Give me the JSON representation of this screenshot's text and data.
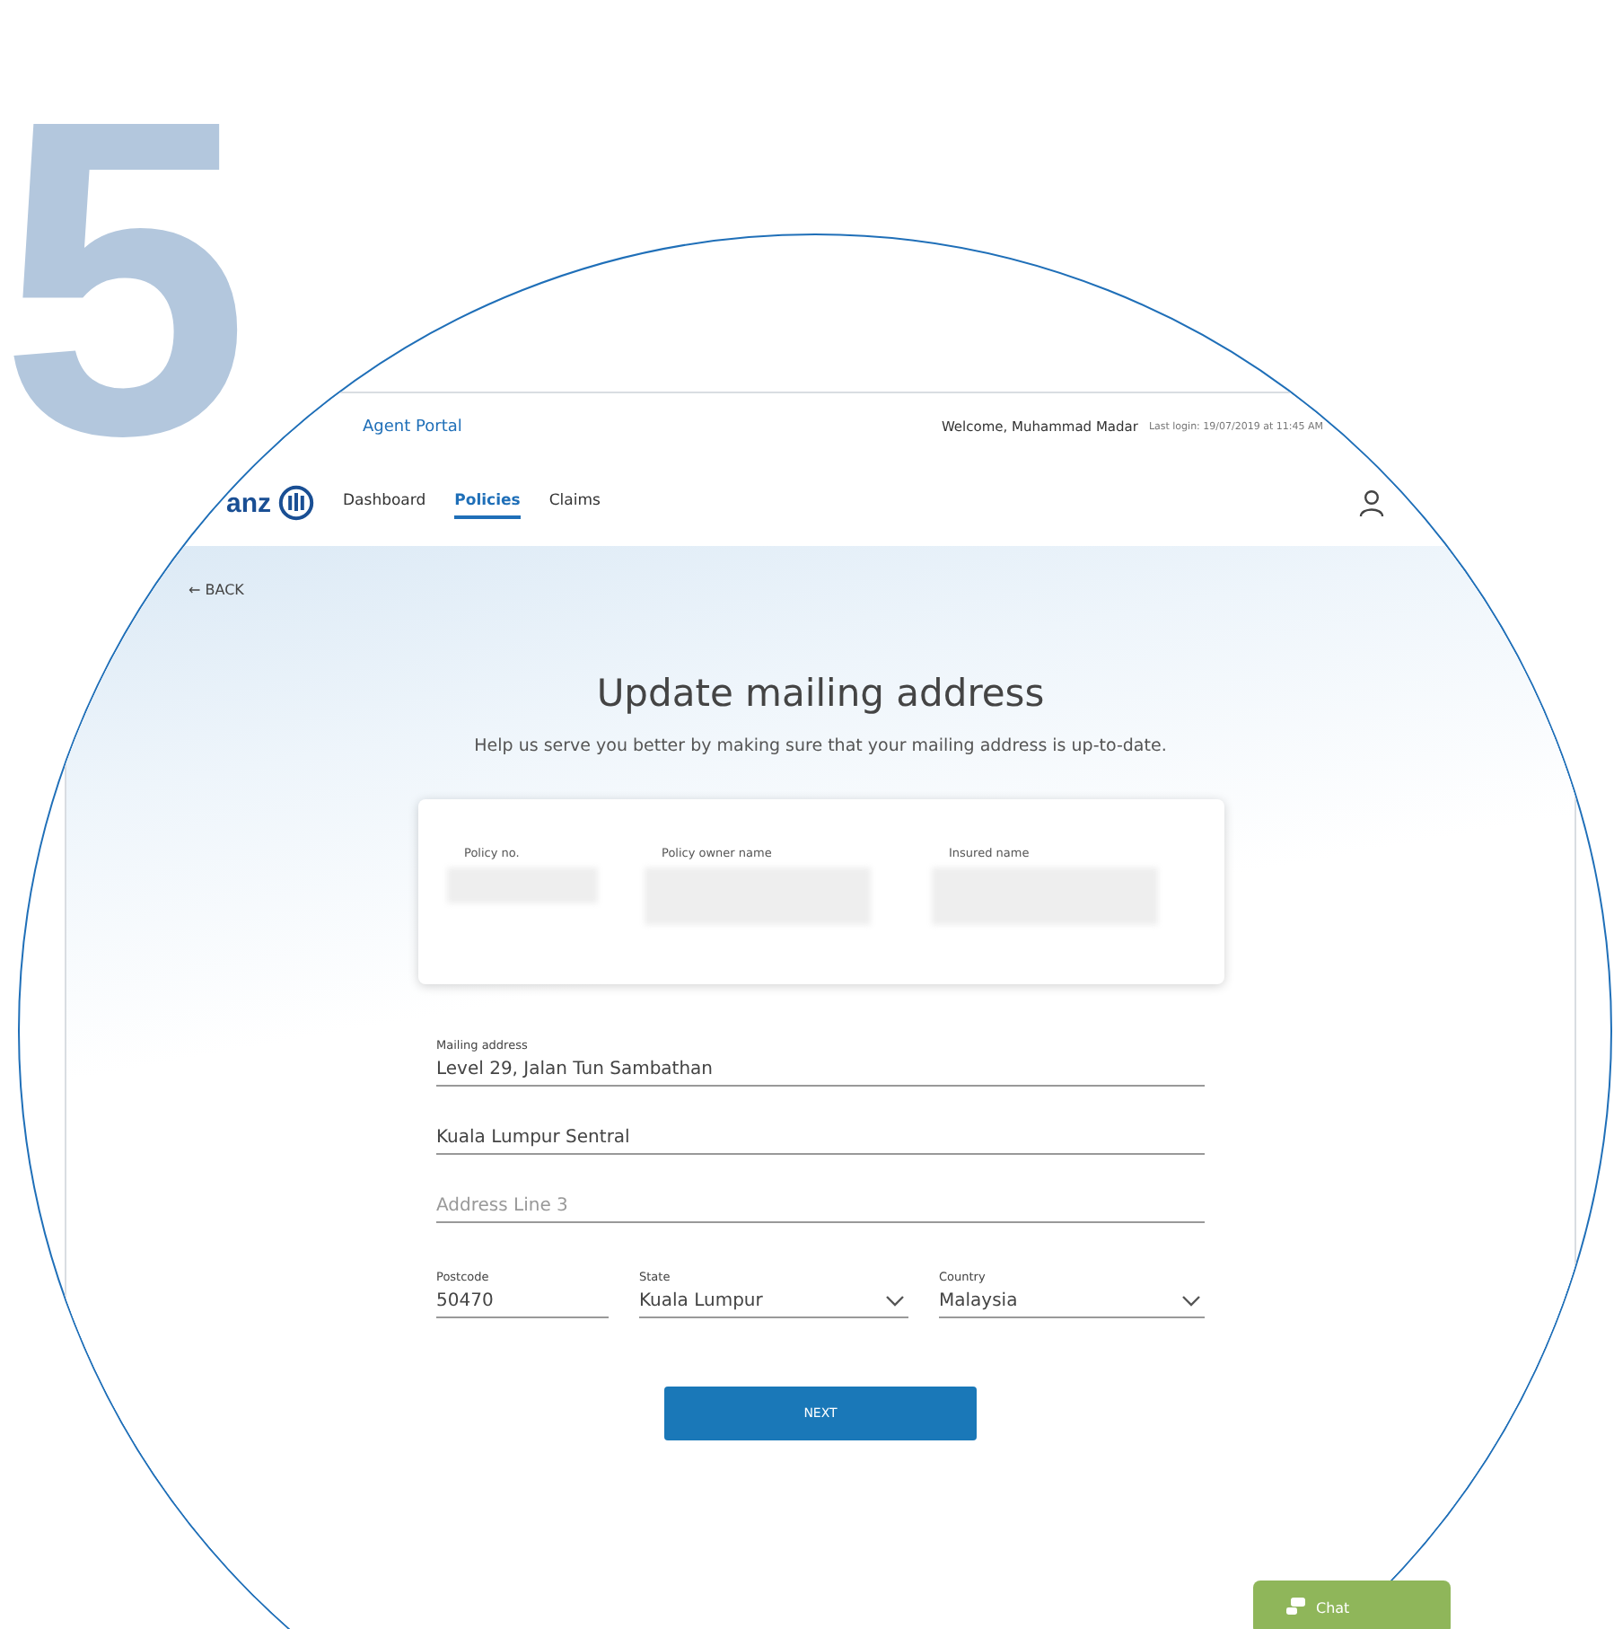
{
  "step_number": "5",
  "top_bar": {
    "portal_name": "Agent Portal",
    "welcome": "Welcome, Muhammad Madar",
    "last_login": "Last login: 19/07/2019 at 11:45 AM"
  },
  "nav": {
    "logo": "anz",
    "tabs": [
      {
        "label": "Dashboard",
        "selected": false
      },
      {
        "label": "Policies",
        "selected": true
      },
      {
        "label": "Claims",
        "selected": false
      }
    ]
  },
  "back": "← BACK",
  "title": "Update mailing address",
  "subtitle": "Help us serve you better by making sure that your mailing address is up-to-date.",
  "policy_card": {
    "fields": [
      {
        "label": "Policy no."
      },
      {
        "label": "Policy owner name"
      },
      {
        "label": "Insured name"
      }
    ]
  },
  "form": {
    "mailing_address_label": "Mailing address",
    "address_lines": [
      {
        "value": "Level 29, Jalan Tun Sambathan"
      },
      {
        "value": "Kuala Lumpur Sentral"
      },
      {
        "placeholder": "Address Line 3"
      }
    ],
    "postcode": {
      "label": "Postcode",
      "value": "50470"
    },
    "state": {
      "label": "State",
      "value": "Kuala Lumpur"
    },
    "country": {
      "label": "Country",
      "value": "Malaysia"
    }
  },
  "next_button": "NEXT",
  "chat_button": "Chat"
}
